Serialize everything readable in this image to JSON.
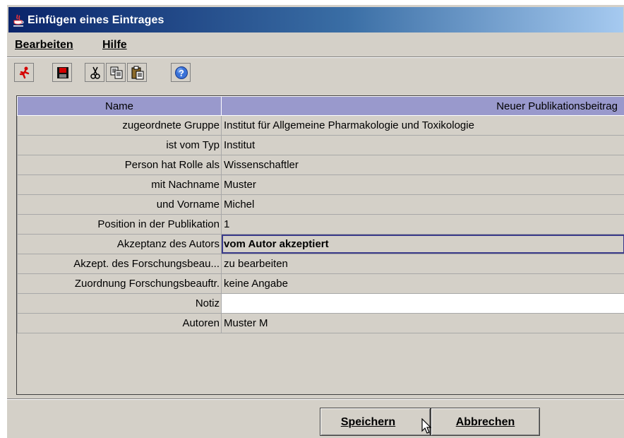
{
  "window": {
    "title": "Einfügen eines Eintrages"
  },
  "menu": [
    {
      "label": "Bearbeiten"
    },
    {
      "label": "Hilfe"
    }
  ],
  "toolbar": {
    "icons": [
      "exit-icon",
      "save-icon",
      "cut-icon",
      "copy-icon",
      "paste-icon",
      "help-icon"
    ]
  },
  "table": {
    "headers": [
      "Name",
      "Neuer Publikationsbeitrag"
    ],
    "rows": [
      {
        "label": "zugeordnete Gruppe",
        "value": "Institut für Allgemeine Pharmakologie und Toxikologie"
      },
      {
        "label": "ist vom Typ",
        "value": "Institut"
      },
      {
        "label": "Person hat Rolle als",
        "value": "Wissenschaftler"
      },
      {
        "label": "mit Nachname",
        "value": "Muster"
      },
      {
        "label": "und Vorname",
        "value": "Michel"
      },
      {
        "label": "Position in der Publikation",
        "value": "1"
      },
      {
        "label": "Akzeptanz des Autors",
        "value": "vom Autor akzeptiert"
      },
      {
        "label": "Akzept. des Forschungsbeau...",
        "value": "zu bearbeiten"
      },
      {
        "label": "Zuordnung Forschungsbeauftr.",
        "value": "keine Angabe"
      },
      {
        "label": "Notiz",
        "value": ""
      },
      {
        "label": "Autoren",
        "value": "Muster M"
      }
    ]
  },
  "buttons": {
    "save": "Speichern",
    "cancel": "Abbrechen"
  },
  "colors": {
    "titlebar_start": "#0a246a",
    "titlebar_end": "#a6caf0",
    "header_bg": "#9999cc",
    "window_bg": "#d4d0c8"
  }
}
